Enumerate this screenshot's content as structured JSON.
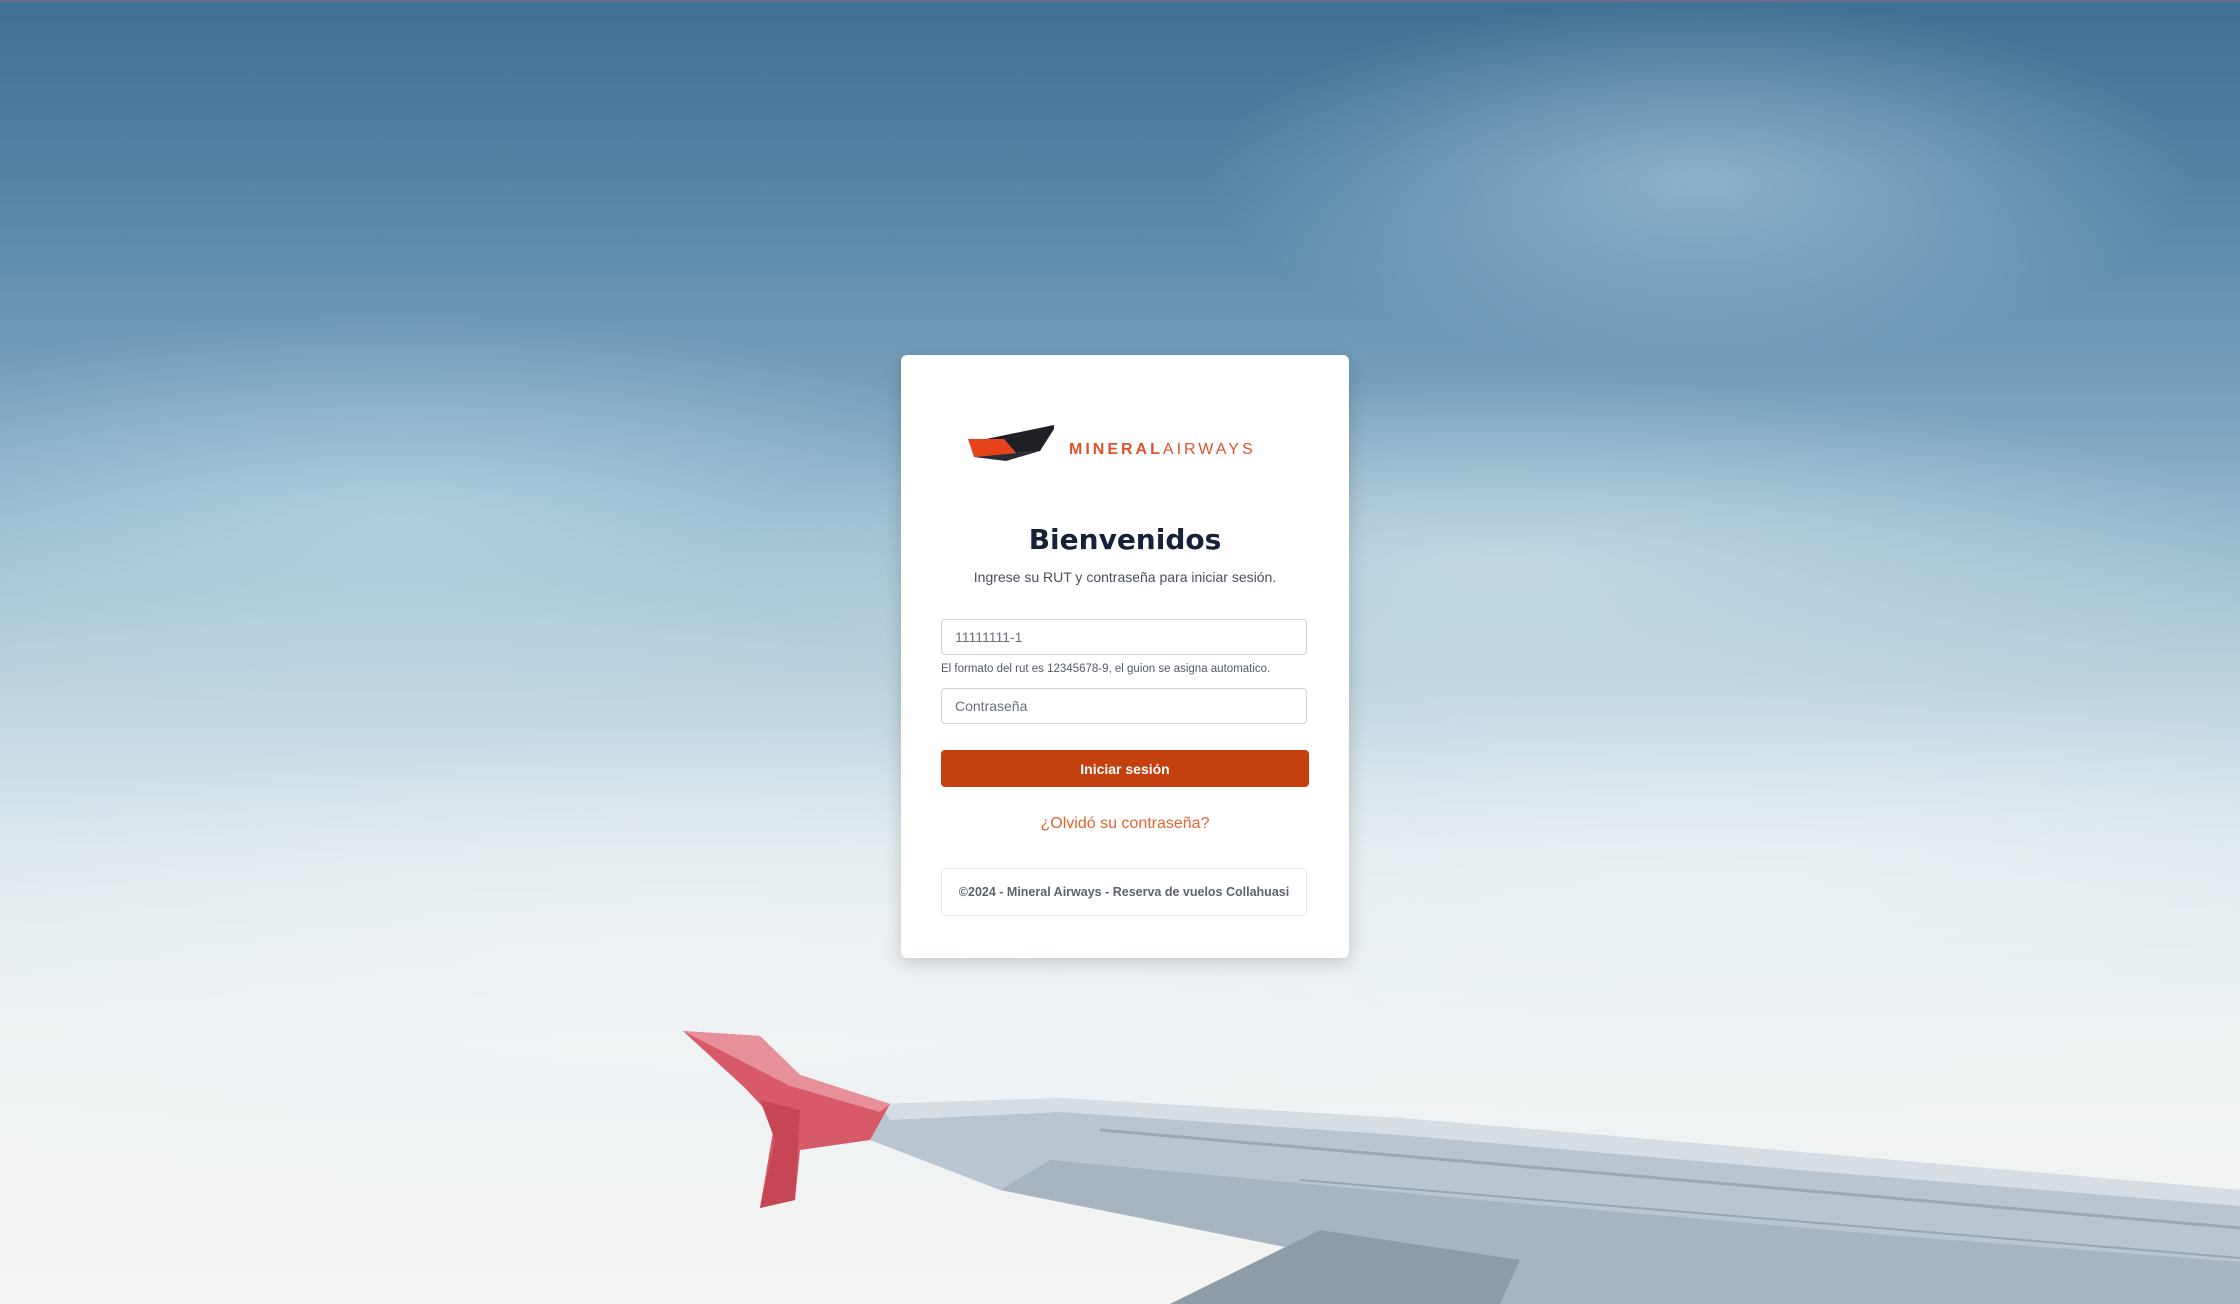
{
  "logo": {
    "brand_bold": "MINERAL",
    "brand_light": "AIRWAYS",
    "icon": "plane-tail-logo-icon"
  },
  "login": {
    "title": "Bienvenidos",
    "subtitle": "Ingrese su RUT y contraseña para iniciar sesión.",
    "rut_placeholder": "11111111-1",
    "rut_hint": "El formato del rut es 12345678-9, el guion se asigna automatico.",
    "password_placeholder": "Contraseña",
    "submit_label": "Iniciar sesión",
    "forgot_label": "¿Olvidó su contraseña?"
  },
  "footer": {
    "text": "©2024 - Mineral Airways - Reserva de vuelos Collahuasi"
  },
  "colors": {
    "accent": "#c4400f",
    "link": "#e2642e",
    "title": "#17213a"
  }
}
